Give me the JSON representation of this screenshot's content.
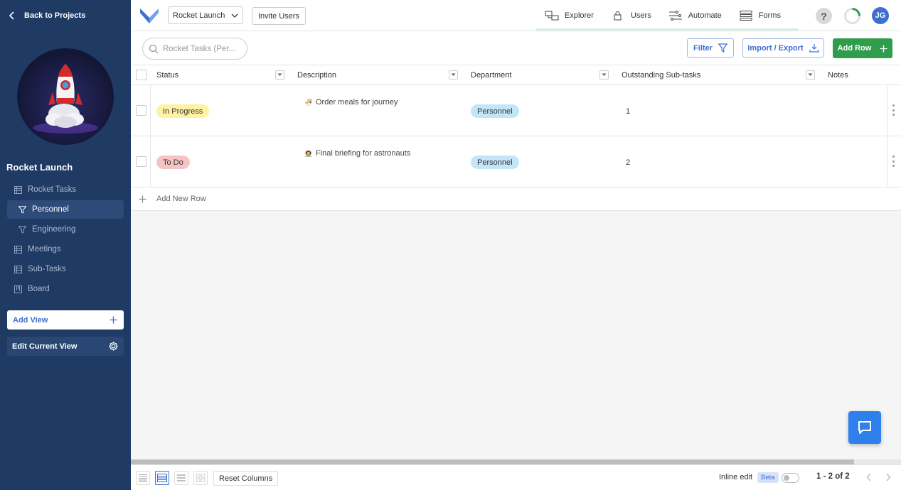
{
  "sidebar": {
    "back_label": "Back to Projects",
    "project_title": "Rocket Launch",
    "items": [
      {
        "label": "Rocket Tasks",
        "icon": "table-icon"
      },
      {
        "label": "Personnel",
        "icon": "filter-icon"
      },
      {
        "label": "Engineering",
        "icon": "filter-icon"
      },
      {
        "label": "Meetings",
        "icon": "table-icon"
      },
      {
        "label": "Sub-Tasks",
        "icon": "table-icon"
      },
      {
        "label": "Board",
        "icon": "board-icon"
      }
    ],
    "add_view_label": "Add View",
    "edit_view_label": "Edit Current View"
  },
  "topbar": {
    "project_select": "Rocket Launch",
    "invite_label": "Invite Users",
    "tabs": [
      {
        "label": "Explorer",
        "icon": "explorer-icon"
      },
      {
        "label": "Users",
        "icon": "lock-icon"
      },
      {
        "label": "Automate",
        "icon": "automate-icon"
      },
      {
        "label": "Forms",
        "icon": "forms-icon"
      }
    ],
    "help_label": "?",
    "user_initials": "JG"
  },
  "toolbar": {
    "search_placeholder": "Rocket Tasks (Per...",
    "filter_label": "Filter",
    "import_label": "Import / Export",
    "add_row_label": "Add Row"
  },
  "table": {
    "columns": [
      "Status",
      "Description",
      "Department",
      "Outstanding Sub-tasks",
      "Notes"
    ],
    "rows": [
      {
        "status": "In Progress",
        "status_color": "#fff3a3",
        "description": "Order meals for journey",
        "emoji": "🍜",
        "department": "Personnel",
        "subtasks": "1",
        "notes": ""
      },
      {
        "status": "To Do",
        "status_color": "#f7c4c4",
        "description": "Final briefing for astronauts",
        "emoji": "👨‍🚀",
        "department": "Personnel",
        "subtasks": "2",
        "notes": ""
      }
    ],
    "add_new_row_label": "Add New Row"
  },
  "footer": {
    "reset_columns_label": "Reset Columns",
    "inline_edit_label": "Inline edit",
    "beta_label": "Beta",
    "pager_text": "1 - 2 of 2"
  },
  "colors": {
    "sidebar_bg": "#1f3a63",
    "accent": "#3d6fd0",
    "add_row_green": "#2f9d4c",
    "department_pill": "#c2e6f8"
  }
}
